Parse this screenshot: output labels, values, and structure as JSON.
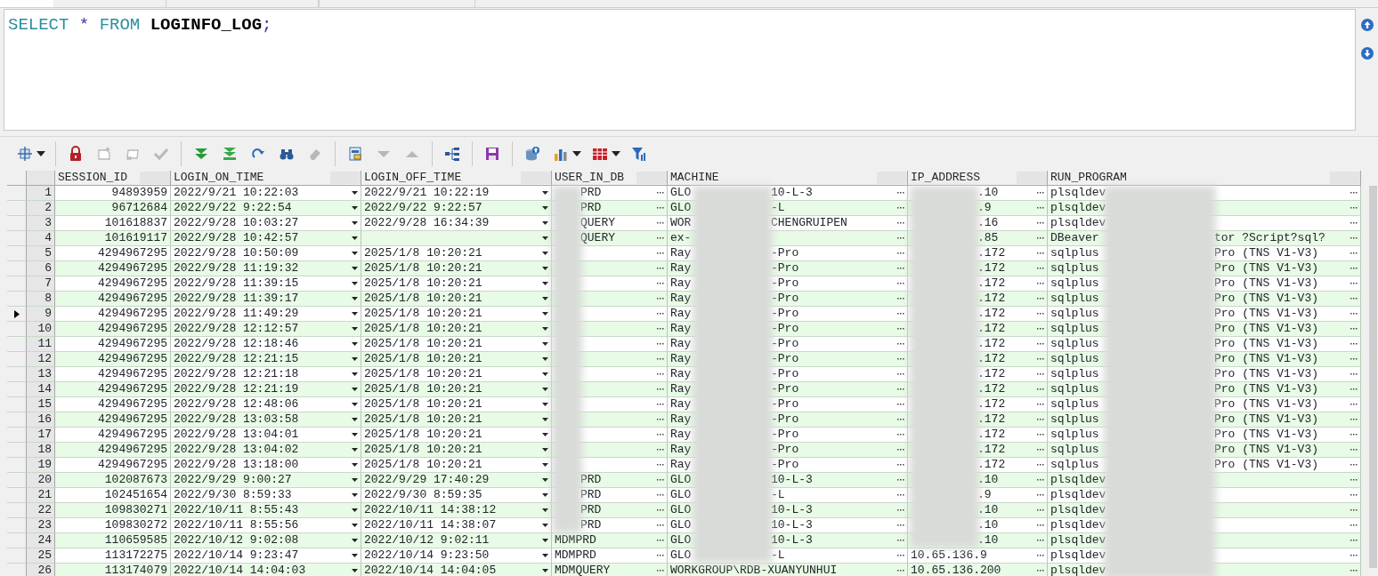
{
  "tabs": [
    {
      "selected": true
    },
    {
      "selected": false
    },
    {
      "selected": false
    }
  ],
  "editor": {
    "tokens": [
      {
        "text": "SELECT",
        "kind": "keyword"
      },
      {
        "text": "*",
        "kind": "operator"
      },
      {
        "text": "FROM",
        "kind": "keyword"
      },
      {
        "text": "LOGINFO_LOG",
        "kind": "identifier"
      },
      {
        "text": ";",
        "kind": "operator"
      }
    ]
  },
  "toolbar": [
    {
      "kind": "select",
      "disabled": false,
      "caret": true
    },
    {
      "kind": "separator"
    },
    {
      "kind": "lock",
      "disabled": false
    },
    {
      "kind": "new",
      "disabled": true
    },
    {
      "kind": "delete",
      "disabled": true
    },
    {
      "kind": "post",
      "disabled": true
    },
    {
      "kind": "separator"
    },
    {
      "kind": "next-page",
      "disabled": false
    },
    {
      "kind": "last-page",
      "disabled": false
    },
    {
      "kind": "refresh",
      "disabled": false
    },
    {
      "kind": "find",
      "disabled": false
    },
    {
      "kind": "clear",
      "disabled": true
    },
    {
      "kind": "separator"
    },
    {
      "kind": "record-view",
      "disabled": false
    },
    {
      "kind": "next",
      "disabled": true
    },
    {
      "kind": "prev",
      "disabled": true
    },
    {
      "kind": "separator"
    },
    {
      "kind": "qbe",
      "disabled": false
    },
    {
      "kind": "separator"
    },
    {
      "kind": "save",
      "disabled": false
    },
    {
      "kind": "separator"
    },
    {
      "kind": "export",
      "disabled": false
    },
    {
      "kind": "chart",
      "disabled": false,
      "caret": true
    },
    {
      "kind": "table",
      "disabled": false,
      "caret": true
    },
    {
      "kind": "filter",
      "disabled": false
    }
  ],
  "table": {
    "columns": [
      "SESSION_ID",
      "LOGIN_ON_TIME",
      "LOGIN_OFF_TIME",
      "USER_IN_DB",
      "MACHINE",
      "IP_ADDRESS",
      "RUN_PROGRAM"
    ],
    "rows": [
      {
        "row": "1",
        "selected": false,
        "session_id": "94893959",
        "login_on_time": "2022/9/21 10:22:03",
        "login_off_time": "2022/9/21 10:22:19",
        "user_in_db": {
          "after": "PRD"
        },
        "machine": {
          "before": "GLO",
          "after": "10-L-3"
        },
        "ip_address": {
          "after": ".10"
        },
        "run_program": {
          "before": "plsqldev"
        }
      },
      {
        "row": "2",
        "selected": false,
        "session_id": "96712684",
        "login_on_time": "2022/9/22 9:22:54",
        "login_off_time": "2022/9/22 9:22:57",
        "user_in_db": {
          "after": "PRD"
        },
        "machine": {
          "before": "GLO",
          "after": "-L"
        },
        "ip_address": {
          "after": ".9"
        },
        "run_program": {
          "before": "plsqldev"
        }
      },
      {
        "row": "3",
        "selected": false,
        "session_id": "101618837",
        "login_on_time": "2022/9/28 10:03:27",
        "login_off_time": "2022/9/28 16:34:39",
        "user_in_db": {
          "after": "QUERY"
        },
        "machine": {
          "before": "WOR",
          "after": "CHENGRUIPEN"
        },
        "ip_address": {
          "after": ".16"
        },
        "run_program": {
          "before": "plsqldev"
        }
      },
      {
        "row": "4",
        "selected": false,
        "session_id": "101619117",
        "login_on_time": "2022/9/28 10:42:57",
        "user_in_db": {
          "after": "QUERY"
        },
        "machine": {
          "before": "ex-"
        },
        "ip_address": {
          "after": ".85"
        },
        "run_program": {
          "before": "DBeaver",
          "after": "tor ?Script?sql?"
        }
      },
      {
        "row": "5",
        "selected": false,
        "session_id": "4294967295",
        "login_on_time": "2022/9/28 10:50:09",
        "login_off_time": "2025/1/8 10:20:21",
        "machine": {
          "before": "Ray",
          "after": "-Pro"
        },
        "ip_address": {
          "after": ".172"
        },
        "run_program": {
          "before": "sqlplus",
          "after": "Pro (TNS V1-V3)"
        }
      },
      {
        "row": "6",
        "selected": false,
        "session_id": "4294967295",
        "login_on_time": "2022/9/28 11:19:32",
        "login_off_time": "2025/1/8 10:20:21",
        "machine": {
          "before": "Ray",
          "after": "-Pro"
        },
        "ip_address": {
          "after": ".172"
        },
        "run_program": {
          "before": "sqlplus",
          "after": "Pro (TNS V1-V3)"
        }
      },
      {
        "row": "7",
        "selected": false,
        "session_id": "4294967295",
        "login_on_time": "2022/9/28 11:39:15",
        "login_off_time": "2025/1/8 10:20:21",
        "machine": {
          "before": "Ray",
          "after": "-Pro"
        },
        "ip_address": {
          "after": ".172"
        },
        "run_program": {
          "before": "sqlplus",
          "after": "Pro (TNS V1-V3)"
        }
      },
      {
        "row": "8",
        "selected": false,
        "session_id": "4294967295",
        "login_on_time": "2022/9/28 11:39:17",
        "login_off_time": "2025/1/8 10:20:21",
        "machine": {
          "before": "Ray",
          "after": "-Pro"
        },
        "ip_address": {
          "after": ".172"
        },
        "run_program": {
          "before": "sqlplus",
          "after": "Pro (TNS V1-V3)"
        }
      },
      {
        "row": "9",
        "selected": true,
        "session_id": "4294967295",
        "login_on_time": "2022/9/28 11:49:29",
        "login_off_time": "2025/1/8 10:20:21",
        "machine": {
          "before": "Ray",
          "after": "-Pro"
        },
        "ip_address": {
          "after": ".172"
        },
        "run_program": {
          "before": "sqlplus",
          "after": "Pro (TNS V1-V3)"
        }
      },
      {
        "row": "10",
        "selected": false,
        "session_id": "4294967295",
        "login_on_time": "2022/9/28 12:12:57",
        "login_off_time": "2025/1/8 10:20:21",
        "machine": {
          "before": "Ray",
          "after": "-Pro"
        },
        "ip_address": {
          "after": ".172"
        },
        "run_program": {
          "before": "sqlplus",
          "after": "Pro (TNS V1-V3)"
        }
      },
      {
        "row": "11",
        "selected": false,
        "session_id": "4294967295",
        "login_on_time": "2022/9/28 12:18:46",
        "login_off_time": "2025/1/8 10:20:21",
        "machine": {
          "before": "Ray",
          "after": "-Pro"
        },
        "ip_address": {
          "after": ".172"
        },
        "run_program": {
          "before": "sqlplus",
          "after": "Pro (TNS V1-V3)"
        }
      },
      {
        "row": "12",
        "selected": false,
        "session_id": "4294967295",
        "login_on_time": "2022/9/28 12:21:15",
        "login_off_time": "2025/1/8 10:20:21",
        "machine": {
          "before": "Ray",
          "after": "-Pro"
        },
        "ip_address": {
          "after": ".172"
        },
        "run_program": {
          "before": "sqlplus",
          "after": "Pro (TNS V1-V3)"
        }
      },
      {
        "row": "13",
        "selected": false,
        "session_id": "4294967295",
        "login_on_time": "2022/9/28 12:21:18",
        "login_off_time": "2025/1/8 10:20:21",
        "machine": {
          "before": "Ray",
          "after": "-Pro"
        },
        "ip_address": {
          "after": ".172"
        },
        "run_program": {
          "before": "sqlplus",
          "after": "Pro (TNS V1-V3)"
        }
      },
      {
        "row": "14",
        "selected": false,
        "session_id": "4294967295",
        "login_on_time": "2022/9/28 12:21:19",
        "login_off_time": "2025/1/8 10:20:21",
        "machine": {
          "before": "Ray",
          "after": "-Pro"
        },
        "ip_address": {
          "after": ".172"
        },
        "run_program": {
          "before": "sqlplus",
          "after": "Pro (TNS V1-V3)"
        }
      },
      {
        "row": "15",
        "selected": false,
        "session_id": "4294967295",
        "login_on_time": "2022/9/28 12:48:06",
        "login_off_time": "2025/1/8 10:20:21",
        "machine": {
          "before": "Ray",
          "after": "-Pro"
        },
        "ip_address": {
          "after": ".172"
        },
        "run_program": {
          "before": "sqlplus",
          "after": "Pro (TNS V1-V3)"
        }
      },
      {
        "row": "16",
        "selected": false,
        "session_id": "4294967295",
        "login_on_time": "2022/9/28 13:03:58",
        "login_off_time": "2025/1/8 10:20:21",
        "machine": {
          "before": "Ray",
          "after": "-Pro"
        },
        "ip_address": {
          "after": ".172"
        },
        "run_program": {
          "before": "sqlplus",
          "after": "Pro (TNS V1-V3)"
        }
      },
      {
        "row": "17",
        "selected": false,
        "session_id": "4294967295",
        "login_on_time": "2022/9/28 13:04:01",
        "login_off_time": "2025/1/8 10:20:21",
        "machine": {
          "before": "Ray",
          "after": "-Pro"
        },
        "ip_address": {
          "after": ".172"
        },
        "run_program": {
          "before": "sqlplus",
          "after": "Pro (TNS V1-V3)"
        }
      },
      {
        "row": "18",
        "selected": false,
        "session_id": "4294967295",
        "login_on_time": "2022/9/28 13:04:02",
        "login_off_time": "2025/1/8 10:20:21",
        "machine": {
          "before": "Ray",
          "after": "-Pro"
        },
        "ip_address": {
          "after": ".172"
        },
        "run_program": {
          "before": "sqlplus",
          "after": "Pro (TNS V1-V3)"
        }
      },
      {
        "row": "19",
        "selected": false,
        "session_id": "4294967295",
        "login_on_time": "2022/9/28 13:18:00",
        "login_off_time": "2025/1/8 10:20:21",
        "machine": {
          "before": "Ray",
          "after": "-Pro"
        },
        "ip_address": {
          "after": ".172"
        },
        "run_program": {
          "before": "sqlplus",
          "after": "Pro (TNS V1-V3)"
        }
      },
      {
        "row": "20",
        "selected": false,
        "session_id": "102087673",
        "login_on_time": "2022/9/29 9:00:27",
        "login_off_time": "2022/9/29 17:40:29",
        "user_in_db": {
          "after": "PRD"
        },
        "machine": {
          "before": "GLO",
          "after": "10-L-3"
        },
        "ip_address": {
          "after": ".10"
        },
        "run_program": {
          "before": "plsqldev"
        }
      },
      {
        "row": "21",
        "selected": false,
        "session_id": "102451654",
        "login_on_time": "2022/9/30 8:59:33",
        "login_off_time": "2022/9/30 8:59:35",
        "user_in_db": {
          "after": "PRD"
        },
        "machine": {
          "before": "GLO",
          "after": "-L"
        },
        "ip_address": {
          "after": ".9"
        },
        "run_program": {
          "before": "plsqldev"
        }
      },
      {
        "row": "22",
        "selected": false,
        "session_id": "109830271",
        "login_on_time": "2022/10/11 8:55:43",
        "login_off_time": "2022/10/11 14:38:12",
        "user_in_db": {
          "after": "PRD"
        },
        "machine": {
          "before": "GLO",
          "after": "10-L-3"
        },
        "ip_address": {
          "after": ".10"
        },
        "run_program": {
          "before": "plsqldev"
        }
      },
      {
        "row": "23",
        "selected": false,
        "session_id": "109830272",
        "login_on_time": "2022/10/11 8:55:56",
        "login_off_time": "2022/10/11 14:38:07",
        "user_in_db": {
          "after": "PRD"
        },
        "machine": {
          "before": "GLO",
          "after": "10-L-3"
        },
        "ip_address": {
          "after": ".10"
        },
        "run_program": {
          "before": "plsqldev"
        }
      },
      {
        "row": "24",
        "selected": false,
        "session_id": "110659585",
        "login_on_time": "2022/10/12 9:02:08",
        "login_off_time": "2022/10/12 9:02:11",
        "user_in_db": {
          "before": "MDMPRD"
        },
        "machine": {
          "before": "GLO",
          "after": "10-L-3"
        },
        "ip_address": {
          "after": ".10"
        },
        "run_program": {
          "before": "plsqldev"
        }
      },
      {
        "row": "25",
        "selected": false,
        "session_id": "113172275",
        "login_on_time": "2022/10/14 9:23:47",
        "login_off_time": "2022/10/14 9:23:50",
        "user_in_db": {
          "before": "MDMPRD"
        },
        "machine": {
          "before": "GLO",
          "after": "-L"
        },
        "ip_address": {
          "before": "10.65.136.9"
        },
        "run_program": {
          "before": "plsqldev"
        }
      },
      {
        "row": "26",
        "selected": false,
        "session_id": "113174079",
        "login_on_time": "2022/10/14 14:04:03",
        "login_off_time": "2022/10/14 14:04:05",
        "user_in_db": {
          "before": "MDMQUERY"
        },
        "machine": {
          "before": "WORKGROUP\\RDB-XUANYUNHUI"
        },
        "ip_address": {
          "before": "10.65.136.200"
        },
        "run_program": {
          "before": "plsqldev"
        }
      }
    ]
  }
}
